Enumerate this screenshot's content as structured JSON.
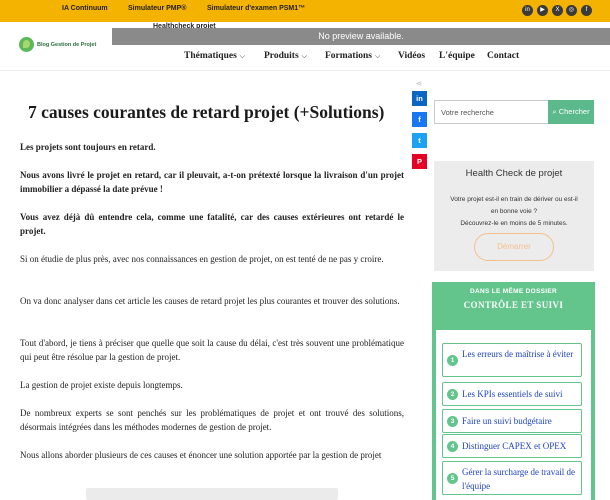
{
  "topbar": {
    "links": [
      "IA Continuum",
      "Simulateur PMP®",
      "Simulateur d'examen PSM1™"
    ],
    "healthcheck_link": "Healthcheck projet",
    "social_icons": [
      "linkedin-icon",
      "youtube-icon",
      "twitter-x-icon",
      "instagram-icon",
      "facebook-icon"
    ],
    "preview_text": "No preview available."
  },
  "header": {
    "logo_text": "Blog Gestion de Projet",
    "nav": [
      "Thématiques",
      "Produits",
      "Formations",
      "Vidéos",
      "L'équipe",
      "Contact"
    ]
  },
  "share": {
    "buttons": [
      "in",
      "f",
      "t",
      "P"
    ],
    "colors": [
      "#0a66c2",
      "#1877f2",
      "#1da1f2",
      "#e60023"
    ]
  },
  "article": {
    "title": "7 causes courantes de retard projet (+Solutions)",
    "paragraphs": [
      "Les projets sont toujours en retard.",
      "Nous avons livré le projet en retard, car il pleuvait, a-t-on prétexté lorsque la livraison d'un projet immobilier a dépassé la date prévue !",
      "Vous avez déjà dû entendre cela, comme une fatalité, car des causes extérieures ont retardé le projet.",
      "Si on étudie de plus près, avec nos connaissances en gestion de projet, on est tenté de ne pas y croire.",
      "On va donc analyser dans cet article les causes de retard projet les plus courantes et trouver des solutions.",
      "Tout d'abord, je tiens à préciser que quelle que soit la cause du délai, c'est très souvent une problématique qui peut être résolue par la gestion de projet.",
      "La gestion de projet existe depuis longtemps.",
      "De nombreux experts se sont penchés sur les problématiques de projet et ont trouvé des solutions, désormais intégrées dans les méthodes modernes de gestion de projet.",
      "Nous allons aborder plusieurs de ces causes et énoncer une solution apportée par la gestion de projet"
    ]
  },
  "sidebar": {
    "search_placeholder": "Votre recherche",
    "search_button": "Chercher",
    "healthcheck": {
      "title": "Health Check de projet",
      "text_line1": "Votre projet est-il en train de dériver ou est-il",
      "text_line2": "en bonne voie ?",
      "text_line3": "Découvrez-le en moins de 5 minutes.",
      "button": "Démarrer"
    },
    "dossier": {
      "kicker": "DANS LE MÊME DOSSIER",
      "title": "CONTRÔLE ET SUIVI",
      "items": [
        {
          "num": "1",
          "label": "Les erreurs de maîtrise à éviter"
        },
        {
          "num": "2",
          "label": "Les KPIs essentiels de suivi"
        },
        {
          "num": "3",
          "label": "Faire un suivi budgétaire"
        },
        {
          "num": "4",
          "label": "Distinguer CAPEX et OPEX"
        },
        {
          "num": "5",
          "label": "Gérer la surcharge de travail de l'équipe"
        }
      ]
    }
  },
  "colors": {
    "topbar": "#f5b301",
    "accent_green": "#63c58b",
    "link_blue": "#1e44c4"
  }
}
